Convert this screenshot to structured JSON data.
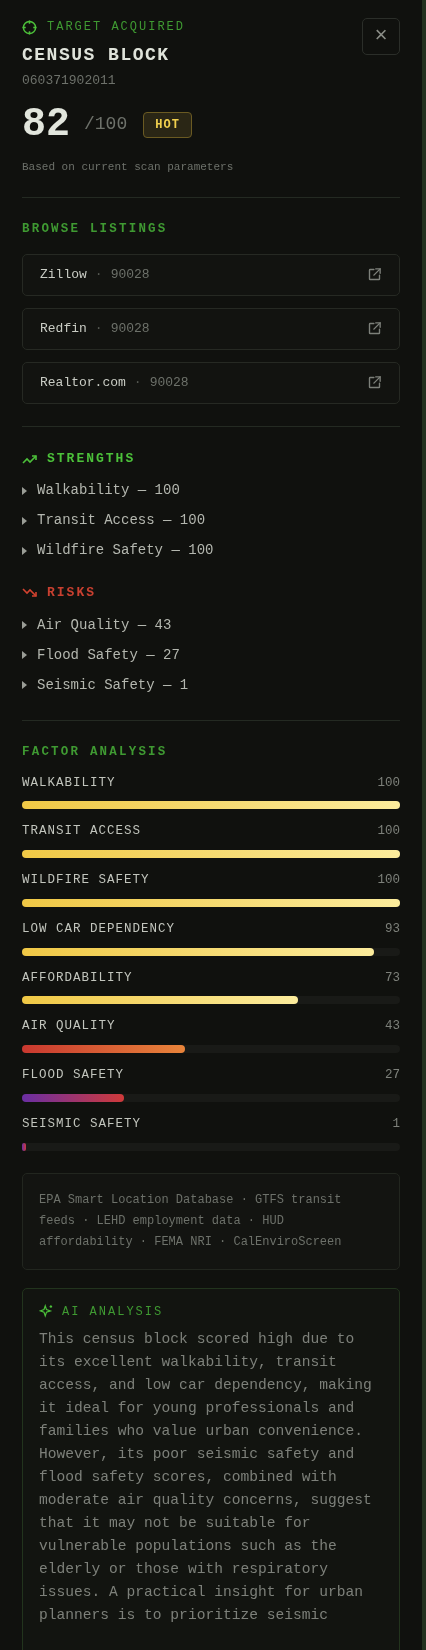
{
  "header": {
    "status": "TARGET ACQUIRED",
    "title": "CENSUS BLOCK",
    "id": "060371902011",
    "close": "×"
  },
  "score": {
    "value": "82",
    "max": "/100",
    "badge": "HOT",
    "caption": "Based on current scan parameters"
  },
  "listings": {
    "title": "BROWSE LISTINGS",
    "items": [
      {
        "name": "Zillow",
        "separator": "·",
        "zip": "90028"
      },
      {
        "name": "Redfin",
        "separator": "·",
        "zip": "90028"
      },
      {
        "name": "Realtor.com",
        "separator": "·",
        "zip": "90028"
      }
    ]
  },
  "strengths": {
    "title": "STRENGTHS",
    "items": [
      "Walkability — 100",
      "Transit Access — 100",
      "Wildfire Safety — 100"
    ]
  },
  "risks": {
    "title": "RISKS",
    "items": [
      "Air Quality — 43",
      "Flood Safety — 27",
      "Seismic Safety — 1"
    ]
  },
  "factors": {
    "title": "FACTOR ANALYSIS",
    "items": [
      {
        "label": "WALKABILITY",
        "reading": "100",
        "level": 1.0
      },
      {
        "label": "TRANSIT ACCESS",
        "reading": "100",
        "level": 1.0
      },
      {
        "label": "WILDFIRE SAFETY",
        "reading": "100",
        "level": 1.0
      },
      {
        "label": "LOW CAR DEPENDENCY",
        "reading": "93",
        "level": 0.93
      },
      {
        "label": "AFFORDABILITY",
        "reading": "73",
        "level": 0.73
      },
      {
        "label": "AIR QUALITY",
        "reading": "43",
        "level": 0.43
      },
      {
        "label": "FLOOD SAFETY",
        "reading": "27",
        "level": 0.27
      },
      {
        "label": "SEISMIC SAFETY",
        "reading": "1",
        "level": 0.01
      }
    ]
  },
  "sources": "EPA Smart Location Database · GTFS transit feeds · LEHD employment data · HUD affordability · FEMA NRI · CalEnviroScreen",
  "ai": {
    "title": "AI ANALYSIS",
    "text": "This census block scored high due to its excellent walkability, transit access, and low car dependency, making it ideal for young professionals and families who value urban convenience. However, its poor seismic safety and flood safety scores, combined with moderate air quality concerns, suggest that it may not be suitable for vulnerable populations such as the elderly or those with respiratory issues. A practical insight for urban planners is to prioritize seismic"
  }
}
